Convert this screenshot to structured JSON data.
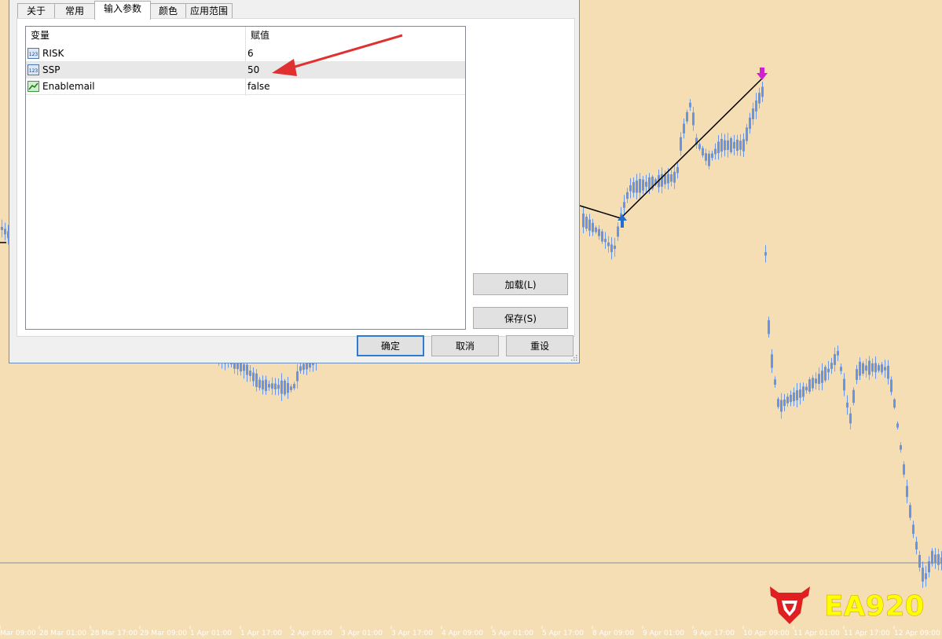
{
  "dialog": {
    "tabs": [
      {
        "label": "关于"
      },
      {
        "label": "常用"
      },
      {
        "label": "输入参数"
      },
      {
        "label": "颜色"
      },
      {
        "label": "应用范围"
      }
    ],
    "active_tab": "输入参数",
    "table": {
      "headers": {
        "variable": "变量",
        "value": "赋值"
      },
      "rows": [
        {
          "name": "RISK",
          "value": "6",
          "icon": "numeric-123-icon"
        },
        {
          "name": "SSP",
          "value": "50",
          "icon": "numeric-123-icon",
          "selected": true
        },
        {
          "name": "Enablemail",
          "value": "false",
          "icon": "boolean-chart-icon"
        }
      ]
    },
    "buttons": {
      "load": "加载(L)",
      "save": "保存(S)",
      "ok": "确定",
      "cancel": "取消",
      "reset": "重设"
    }
  },
  "annotation": {
    "arrow_color": "#E03030"
  },
  "chart": {
    "background": "#F5DEB3",
    "candle_color": "#6495ED",
    "x_labels": [
      "Mar 09:00",
      "28 Mar 01:00",
      "28 Mar 17:00",
      "29 Mar 09:00",
      "1 Apr 01:00",
      "1 Apr 17:00",
      "2 Apr 09:00",
      "3 Apr 01:00",
      "3 Apr 17:00",
      "4 Apr 09:00",
      "5 Apr 01:00",
      "5 Apr 17:00",
      "8 Apr 09:00",
      "9 Apr 01:00",
      "9 Apr 17:00",
      "10 Apr 09:00",
      "11 Apr 01:00",
      "11 Apr 17:00",
      "12 Apr 09:00"
    ],
    "buy_arrow_color": "#1E6FD0",
    "sell_arrow_color": "#D020D0"
  },
  "watermark": {
    "text": "EA920",
    "text_color": "#FFFF00",
    "logo_color": "#E02020"
  }
}
